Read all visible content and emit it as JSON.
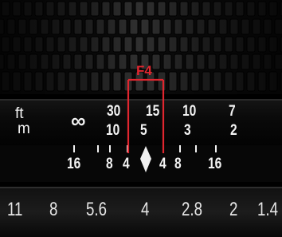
{
  "lens": {
    "annotation": "F4",
    "units": {
      "feet": "ft",
      "meters": "m"
    },
    "distance_feet": [
      "30",
      "15",
      "10",
      "7"
    ],
    "distance_meters": [
      "10",
      "5",
      "3",
      "2"
    ],
    "infinity": "∞",
    "dof_scale": [
      "16",
      "8",
      "4",
      "4",
      "8",
      "16"
    ],
    "aperture_scale": [
      "11",
      "8",
      "5.6",
      "4",
      "2.8",
      "2",
      "1.4"
    ]
  },
  "colors": {
    "annotation": "#e0262f",
    "markings": "#f2f2f2",
    "body": "#0a0a0a"
  }
}
